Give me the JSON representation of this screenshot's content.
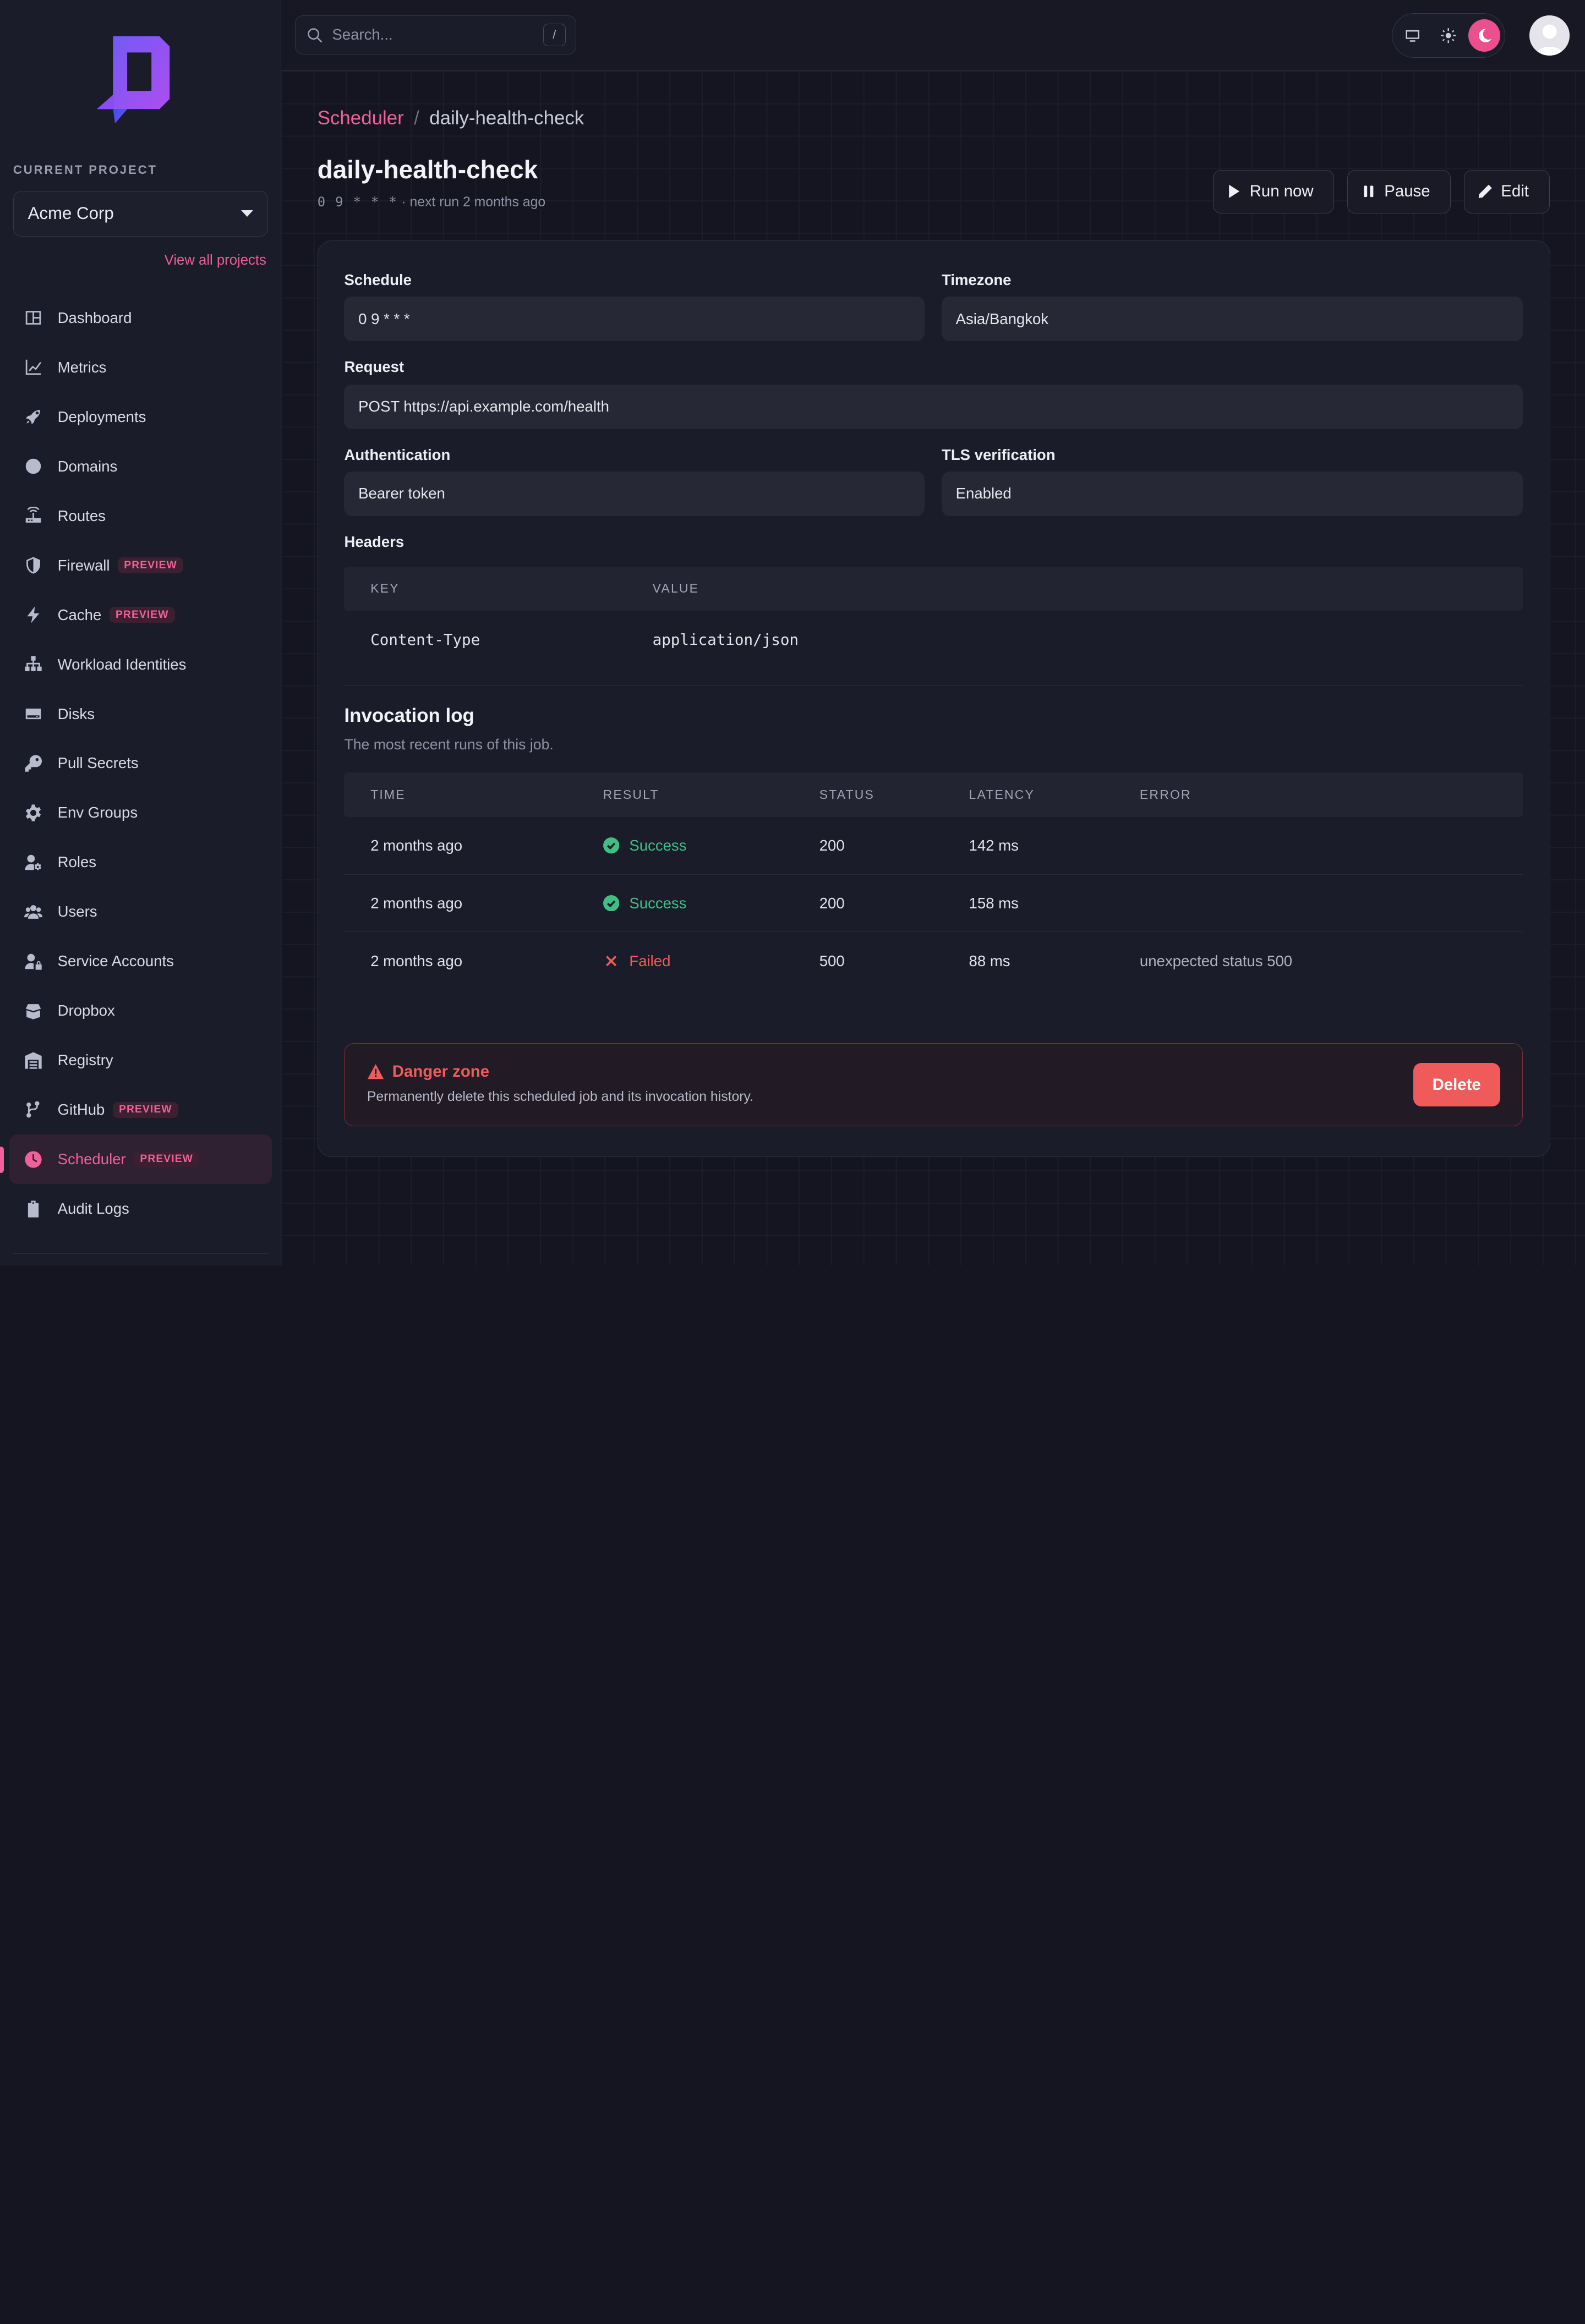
{
  "sidebar": {
    "project_caption": "CURRENT PROJECT",
    "project_name": "Acme Corp",
    "view_all": "View all projects",
    "items": [
      {
        "label": "Dashboard",
        "icon": "dashboard-icon"
      },
      {
        "label": "Metrics",
        "icon": "chart-line-icon"
      },
      {
        "label": "Deployments",
        "icon": "rocket-icon"
      },
      {
        "label": "Domains",
        "icon": "globe-icon"
      },
      {
        "label": "Routes",
        "icon": "router-icon"
      },
      {
        "label": "Firewall",
        "icon": "shield-icon",
        "badge": "PREVIEW"
      },
      {
        "label": "Cache",
        "icon": "lightning-icon",
        "badge": "PREVIEW"
      },
      {
        "label": "Workload Identities",
        "icon": "sitemap-icon"
      },
      {
        "label": "Disks",
        "icon": "disk-icon"
      },
      {
        "label": "Pull Secrets",
        "icon": "key-icon"
      },
      {
        "label": "Env Groups",
        "icon": "gear-icon"
      },
      {
        "label": "Roles",
        "icon": "user-gear-icon"
      },
      {
        "label": "Users",
        "icon": "users-icon"
      },
      {
        "label": "Service Accounts",
        "icon": "user-lock-icon"
      },
      {
        "label": "Dropbox",
        "icon": "box-open-icon"
      },
      {
        "label": "Registry",
        "icon": "warehouse-icon"
      },
      {
        "label": "GitHub",
        "icon": "code-branch-icon",
        "badge": "PREVIEW"
      },
      {
        "label": "Scheduler",
        "icon": "clock-icon",
        "badge": "PREVIEW",
        "active": true
      },
      {
        "label": "Audit Logs",
        "icon": "clipboard-icon"
      }
    ]
  },
  "topbar": {
    "search_placeholder": "Search...",
    "search_shortcut": "/"
  },
  "breadcrumb": {
    "parent": "Scheduler",
    "separator": "/",
    "current": "daily-health-check"
  },
  "job": {
    "title": "daily-health-check",
    "cron": "0 9 * * *",
    "next_run": "· next run 2 months ago"
  },
  "actions": {
    "run_now": "Run now",
    "pause": "Pause",
    "edit": "Edit"
  },
  "details": {
    "schedule_label": "Schedule",
    "schedule_value": "0 9 * * *",
    "timezone_label": "Timezone",
    "timezone_value": "Asia/Bangkok",
    "request_label": "Request",
    "request_value": "POST https://api.example.com/health",
    "auth_label": "Authentication",
    "auth_value": "Bearer token",
    "tls_label": "TLS verification",
    "tls_value": "Enabled",
    "headers_label": "Headers",
    "headers_columns": [
      "KEY",
      "VALUE"
    ],
    "headers": [
      {
        "key": "Content-Type",
        "value": "application/json"
      }
    ]
  },
  "invocation_log": {
    "title": "Invocation log",
    "description": "The most recent runs of this job.",
    "columns": [
      "TIME",
      "RESULT",
      "STATUS",
      "LATENCY",
      "ERROR"
    ],
    "rows": [
      {
        "time": "2 months ago",
        "result": "Success",
        "status": "200",
        "latency": "142 ms",
        "error": ""
      },
      {
        "time": "2 months ago",
        "result": "Success",
        "status": "200",
        "latency": "158 ms",
        "error": ""
      },
      {
        "time": "2 months ago",
        "result": "Failed",
        "status": "500",
        "latency": "88 ms",
        "error": "unexpected status 500"
      }
    ]
  },
  "danger": {
    "title": "Danger zone",
    "description": "Permanently delete this scheduled job and its invocation history.",
    "button": "Delete"
  },
  "colors": {
    "accent": "#f0609a",
    "success": "#3fbf83",
    "danger": "#ef5b5b"
  }
}
